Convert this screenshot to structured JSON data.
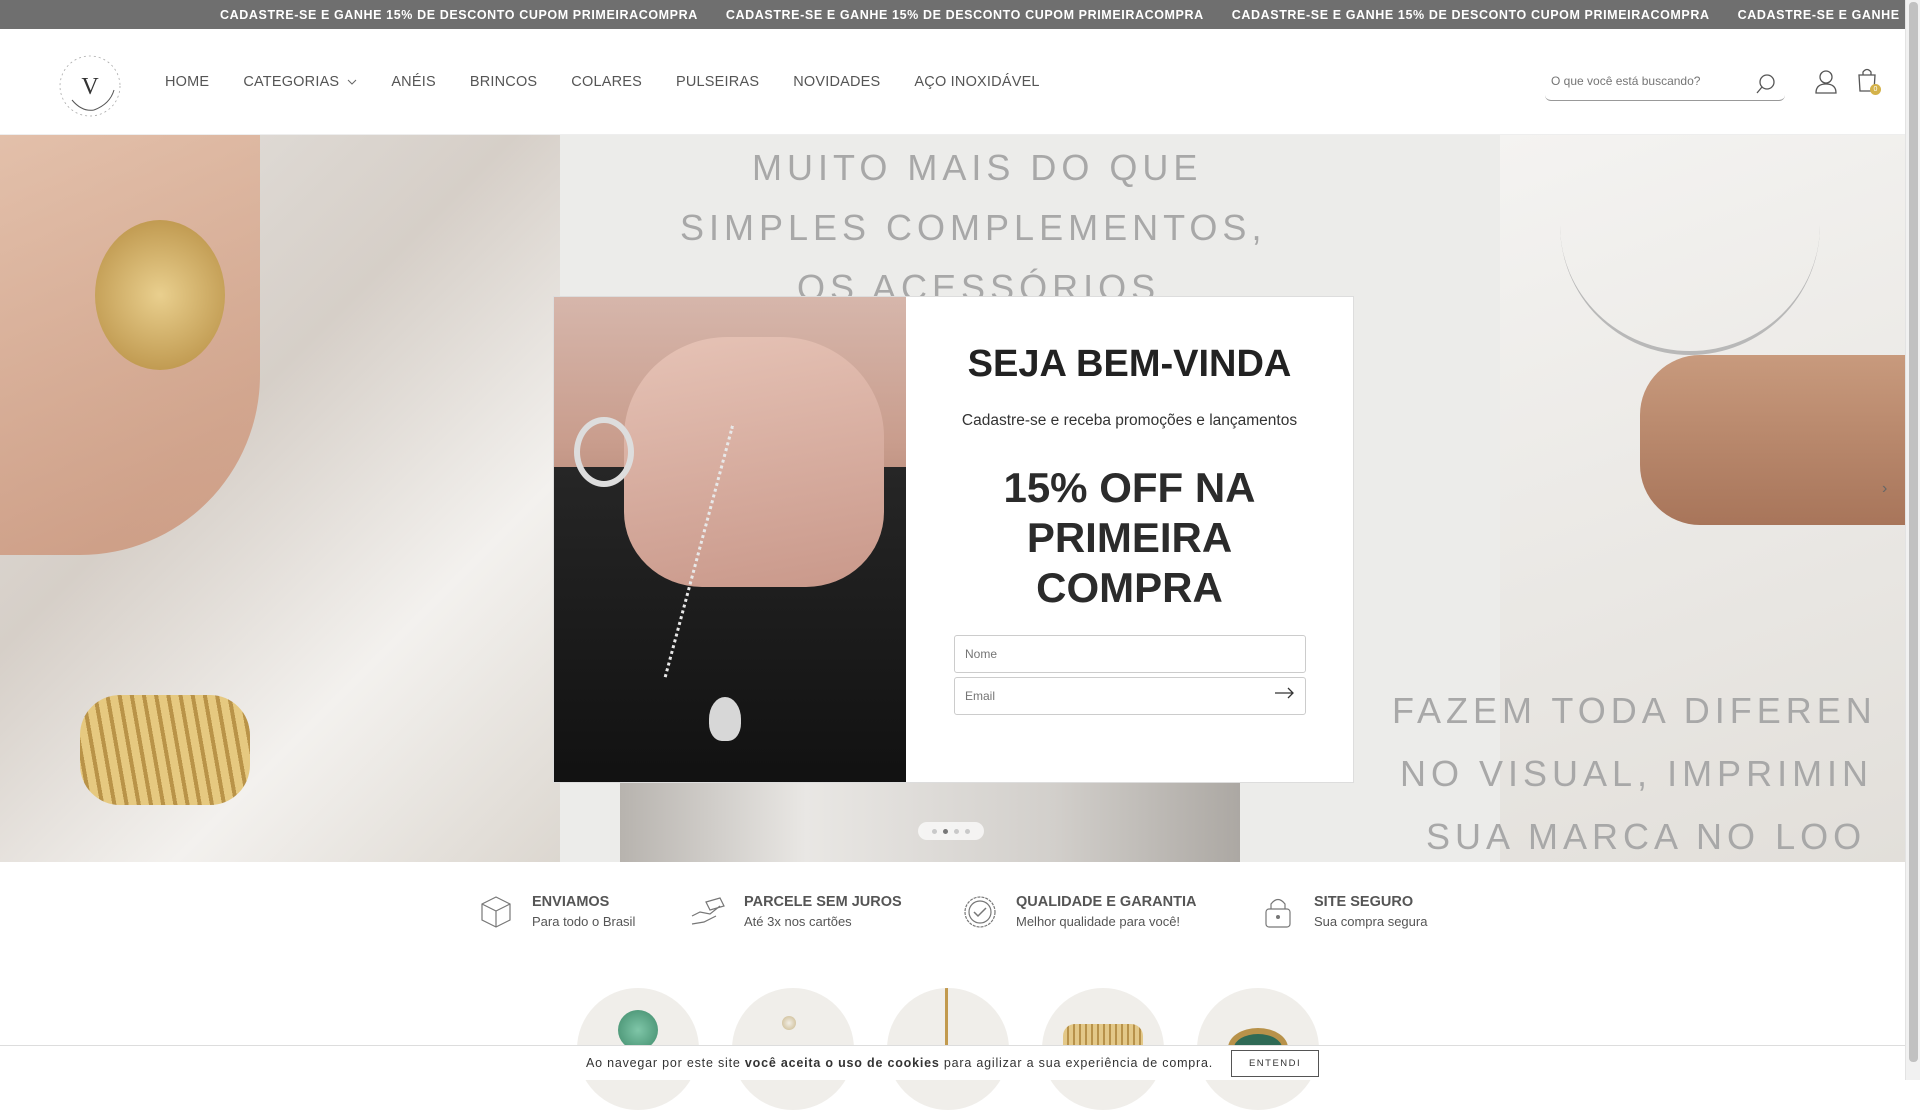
{
  "announcement": {
    "items": [
      "CADASTRE-SE E GANHE 15% DE DESCONTO CUPOM PRIMEIRACOMPRA",
      "CADASTRE-SE E GANHE 15% DE DESCONTO CUPOM PRIMEIRACOMPRA",
      "CADASTRE-SE E GANHE 15% DE DESCONTO CUPOM PRIMEIRACOMPRA",
      "CADASTRE-SE E GANHE"
    ]
  },
  "header": {
    "logo_letter": "V",
    "nav": [
      {
        "label": "HOME"
      },
      {
        "label": "CATEGORIAS",
        "has_dropdown": true
      },
      {
        "label": "ANÉIS"
      },
      {
        "label": "BRINCOS"
      },
      {
        "label": "COLARES"
      },
      {
        "label": "PULSEIRAS"
      },
      {
        "label": "NOVIDADES"
      },
      {
        "label": "AÇO INOXIDÁVEL"
      }
    ],
    "search": {
      "placeholder": "O que você está buscando?",
      "icon": "search-icon"
    },
    "cart": {
      "count": "0"
    }
  },
  "hero": {
    "lines_top": [
      "MUITO MAIS DO QUE",
      "SIMPLES COMPLEMENTOS,",
      "OS ACESSÓRIOS"
    ],
    "lines_bottom": [
      "FAZEM TODA DIFEREN",
      "NO VISUAL, IMPRIMIN",
      "SUA MARCA NO LOO"
    ],
    "arrow": "›",
    "active_slide": 2,
    "slide_count": 4
  },
  "popup": {
    "title": "SEJA BEM-VINDA",
    "subtitle": "Cadastre-se e receba promoções e lançamentos",
    "offer": "15% OFF NA PRIMEIRA COMPRA",
    "name_placeholder": "Nome",
    "email_placeholder": "Email",
    "submit_icon": "arrow-right-icon"
  },
  "features": [
    {
      "title": "ENVIAMOS",
      "desc": "Para todo o Brasil",
      "icon": "box-icon"
    },
    {
      "title": "PARCELE SEM JUROS",
      "desc": "Até 3x nos cartões",
      "icon": "hand-card-icon"
    },
    {
      "title": "QUALIDADE E GARANTIA",
      "desc": "Melhor qualidade para você!",
      "icon": "check-badge-icon"
    },
    {
      "title": "SITE SEGURO",
      "desc": "Sua compra segura",
      "icon": "lock-icon"
    }
  ],
  "cookie": {
    "text_before": "Ao navegar por este site ",
    "text_bold": "você aceita o uso de cookies",
    "text_after": " para agilizar a sua experiência de compra.",
    "button": "ENTENDI"
  },
  "colors": {
    "topbar": "#6f6f6f",
    "accent": "#d4b24a"
  }
}
